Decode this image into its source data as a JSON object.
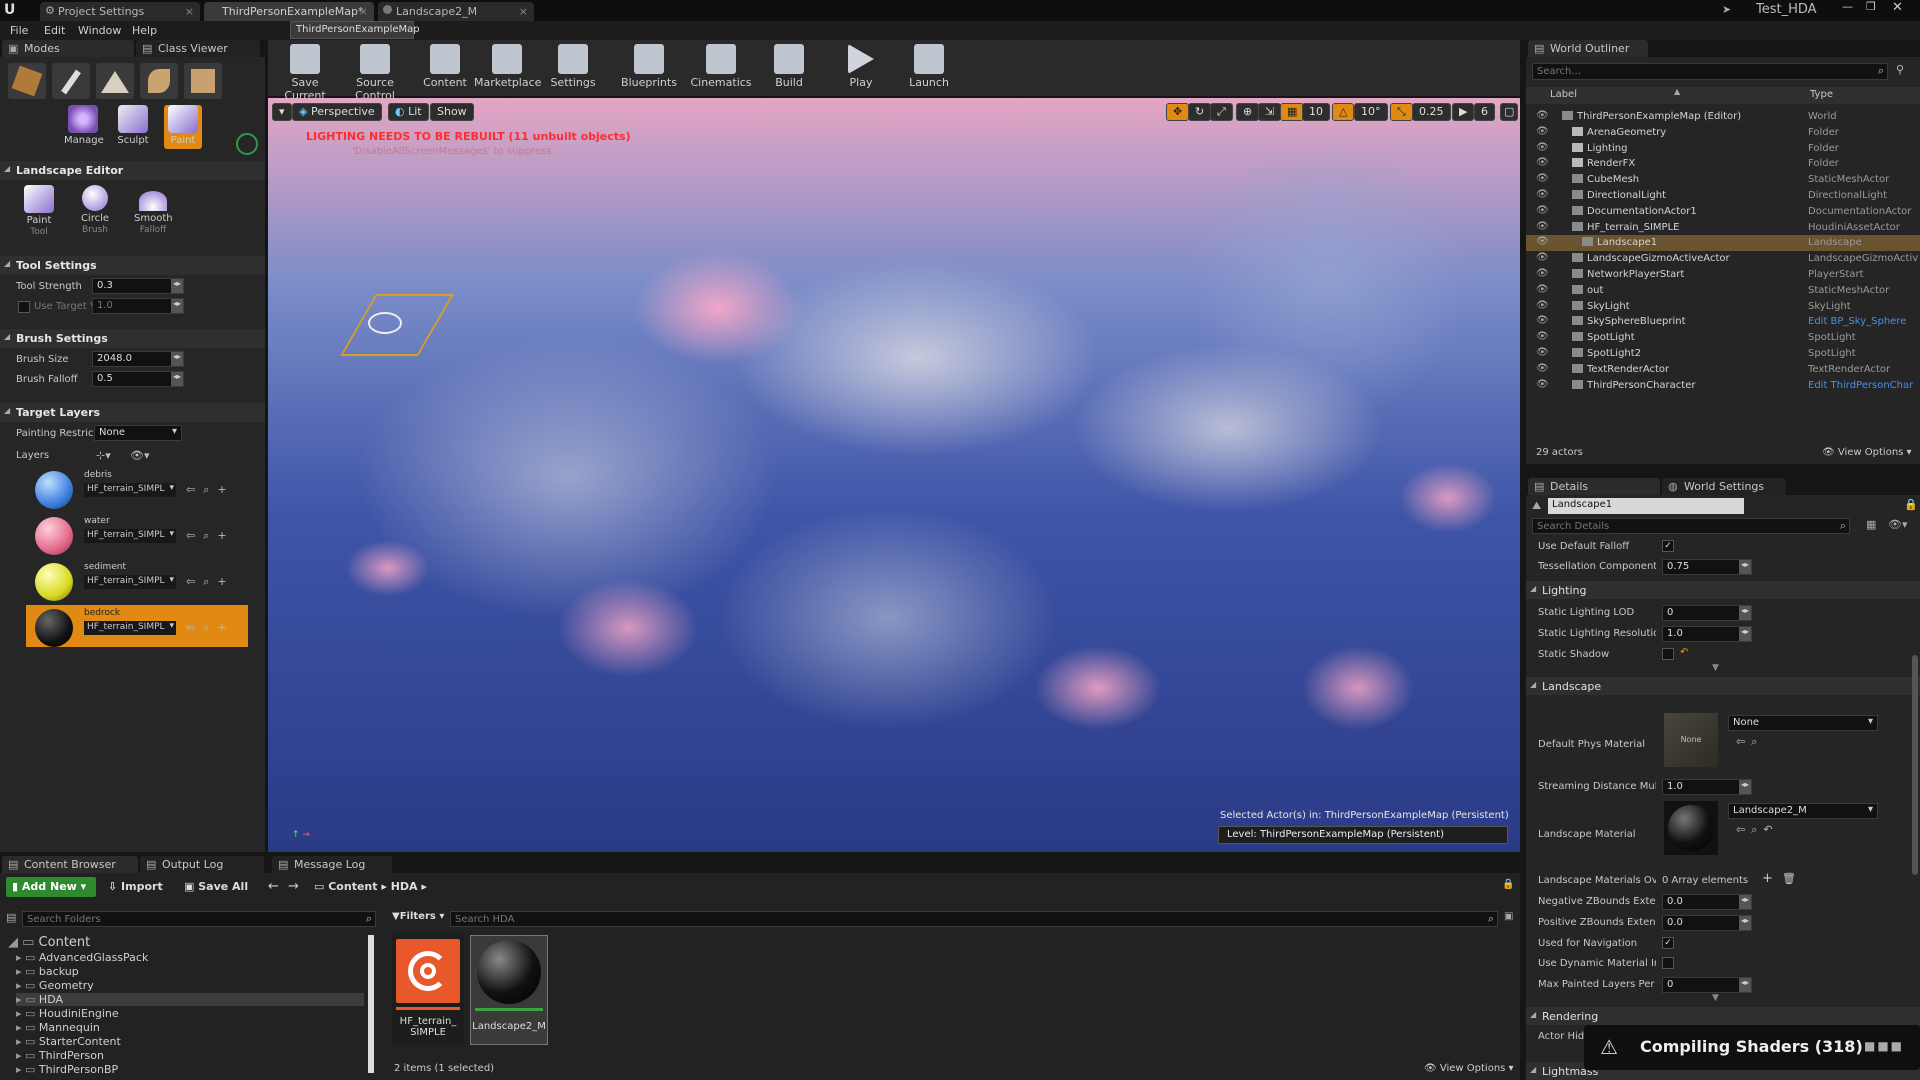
{
  "app": {
    "window_title": "Test_HDA",
    "logo": "unreal-logo"
  },
  "doc_tabs": [
    {
      "label": "Project Settings"
    },
    {
      "label": "ThirdPersonExampleMap*"
    },
    {
      "label": "Landscape2_M"
    }
  ],
  "tooltip": "ThirdPersonExampleMap",
  "menu": [
    "File",
    "Edit",
    "Window",
    "Help"
  ],
  "left_tabs": {
    "modes": "Modes",
    "class_viewer": "Class Viewer"
  },
  "landscape_modes": {
    "manage": "Manage",
    "sculpt": "Sculpt",
    "paint": "Paint"
  },
  "landscape_editor": {
    "title": "Landscape Editor",
    "tools": [
      {
        "label": "Paint",
        "sub": "Tool"
      },
      {
        "label": "Circle",
        "sub": "Brush"
      },
      {
        "label": "Smooth",
        "sub": "Falloff"
      }
    ]
  },
  "tool_settings": {
    "title": "Tool Settings",
    "strength_label": "Tool Strength",
    "strength_value": "0.3",
    "use_target_label": "Use Target V",
    "use_target_value": "1.0"
  },
  "brush_settings": {
    "title": "Brush Settings",
    "size_label": "Brush Size",
    "size_value": "2048.0",
    "falloff_label": "Brush Falloff",
    "falloff_value": "0.5"
  },
  "target_layers": {
    "title": "Target Layers",
    "restrict_label": "Painting Restric",
    "restrict_value": "None",
    "layers_label": "Layers",
    "layers": [
      {
        "name": "debris",
        "asset": "HF_terrain_SIMPL",
        "color": "#3f7fe0"
      },
      {
        "name": "water",
        "asset": "HF_terrain_SIMPL",
        "color": "#e36a8a"
      },
      {
        "name": "sediment",
        "asset": "HF_terrain_SIMPL",
        "color": "#d9d924"
      },
      {
        "name": "bedrock",
        "asset": "HF_terrain_SIMPL",
        "color": "#111111"
      }
    ]
  },
  "toolbar": [
    {
      "label": "Save Current"
    },
    {
      "label": "Source Control"
    },
    {
      "label": "Content"
    },
    {
      "label": "Marketplace"
    },
    {
      "label": "Settings"
    },
    {
      "label": "Blueprints"
    },
    {
      "label": "Cinematics"
    },
    {
      "label": "Build"
    },
    {
      "label": "Play"
    },
    {
      "label": "Launch"
    }
  ],
  "viewport": {
    "perspective": "Perspective",
    "lit": "Lit",
    "show": "Show",
    "warning": "LIGHTING NEEDS TO BE REBUILT (11 unbuilt objects)",
    "warning_sub": "'DisableAllScreenMessages' to suppress",
    "grid_snap": "10",
    "rot_snap": "10°",
    "scale_snap": "0.25",
    "cam_speed": "6",
    "selected_info": "Selected Actor(s) in:  ThirdPersonExampleMap (Persistent)",
    "level_label": "Level:",
    "level_value": "ThirdPersonExampleMap (Persistent)"
  },
  "outliner": {
    "tab": "World Outliner",
    "search_placeholder": "Search...",
    "col_label": "Label",
    "col_type": "Type",
    "rows": [
      {
        "label": "ThirdPersonExampleMap (Editor)",
        "type": "World",
        "indent": 0
      },
      {
        "label": "ArenaGeometry",
        "type": "Folder",
        "indent": 1
      },
      {
        "label": "Lighting",
        "type": "Folder",
        "indent": 1
      },
      {
        "label": "RenderFX",
        "type": "Folder",
        "indent": 1
      },
      {
        "label": "CubeMesh",
        "type": "StaticMeshActor",
        "indent": 1
      },
      {
        "label": "DirectionalLight",
        "type": "DirectionalLight",
        "indent": 1
      },
      {
        "label": "DocumentationActor1",
        "type": "DocumentationActor",
        "indent": 1
      },
      {
        "label": "HF_terrain_SIMPLE",
        "type": "HoudiniAssetActor",
        "indent": 1
      },
      {
        "label": "Landscape1",
        "type": "Landscape",
        "indent": 2
      },
      {
        "label": "LandscapeGizmoActiveActor",
        "type": "LandscapeGizmoActiv",
        "indent": 1
      },
      {
        "label": "NetworkPlayerStart",
        "type": "PlayerStart",
        "indent": 1
      },
      {
        "label": "out",
        "type": "StaticMeshActor",
        "indent": 1
      },
      {
        "label": "SkyLight",
        "type": "SkyLight",
        "indent": 1
      },
      {
        "label": "SkySphereBlueprint",
        "type": "Edit BP_Sky_Sphere",
        "indent": 1
      },
      {
        "label": "SpotLight",
        "type": "SpotLight",
        "indent": 1
      },
      {
        "label": "SpotLight2",
        "type": "SpotLight",
        "indent": 1
      },
      {
        "label": "TextRenderActor",
        "type": "TextRenderActor",
        "indent": 1
      },
      {
        "label": "ThirdPersonCharacter",
        "type": "Edit ThirdPersonChar",
        "indent": 1
      }
    ],
    "count": "29 actors",
    "view_options": "View Options"
  },
  "details": {
    "tab": "Details",
    "world_tab": "World Settings",
    "object_name": "Landscape1",
    "search_placeholder": "Search Details",
    "use_default_falloff": "Use Default Falloff",
    "tess_label": "Tessellation Component S",
    "tess_value": "0.75",
    "lighting": "Lighting",
    "static_lod_label": "Static Lighting LOD",
    "static_lod_value": "0",
    "static_res_label": "Static Lighting Resolution",
    "static_res_value": "1.0",
    "static_shadow": "Static Shadow",
    "landscape": "Landscape",
    "phys_label": "Default Phys Material",
    "phys_thumb": "None",
    "phys_value": "None",
    "stream_label": "Streaming Distance Multip",
    "stream_value": "1.0",
    "mat_label": "Landscape Material",
    "mat_value": "Landscape2_M",
    "mat_over_label": "Landscape Materials Over",
    "mat_over_value": "0 Array elements",
    "neg_z_label": "Negative ZBounds Extens",
    "neg_z_value": "0.0",
    "pos_z_label": "Positive ZBounds Extensi",
    "pos_z_value": "0.0",
    "nav_label": "Used for Navigation",
    "dyn_label": "Use Dynamic Material Inst",
    "max_painted_label": "Max Painted Layers Per C",
    "max_painted_value": "0",
    "rendering": "Rendering",
    "actor_hidden": "Actor Hid",
    "lightmass": "Lightmass"
  },
  "bottom_tabs": {
    "content_browser": "Content Browser",
    "output_log": "Output Log",
    "message_log": "Message Log"
  },
  "content_browser": {
    "add_new": "Add New",
    "import": "Import",
    "save_all": "Save All",
    "path": [
      "Content",
      "HDA"
    ],
    "search_folders": "Search Folders",
    "filters": "Filters",
    "search_assets": "Search HDA",
    "folders": [
      "Content",
      "AdvancedGlassPack",
      "backup",
      "Geometry",
      "HDA",
      "HoudiniEngine",
      "Mannequin",
      "StarterContent",
      "ThirdPerson",
      "ThirdPersonBP"
    ],
    "assets": [
      {
        "name": "HF_terrain_\nSIMPLE"
      },
      {
        "name": "Landscape2_M"
      }
    ],
    "status": "2 items (1 selected)",
    "view_options": "View Options"
  },
  "toast": {
    "text": "Compiling Shaders (318)"
  }
}
